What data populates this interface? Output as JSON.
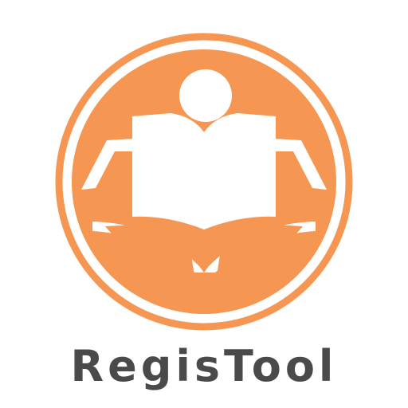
{
  "app": {
    "name": "RegisTool"
  },
  "logo": {
    "icon": "reading-person-book-icon",
    "brand_color": "#f59752",
    "background_color": "#ffffff",
    "text_color": "#4a4a4a"
  }
}
